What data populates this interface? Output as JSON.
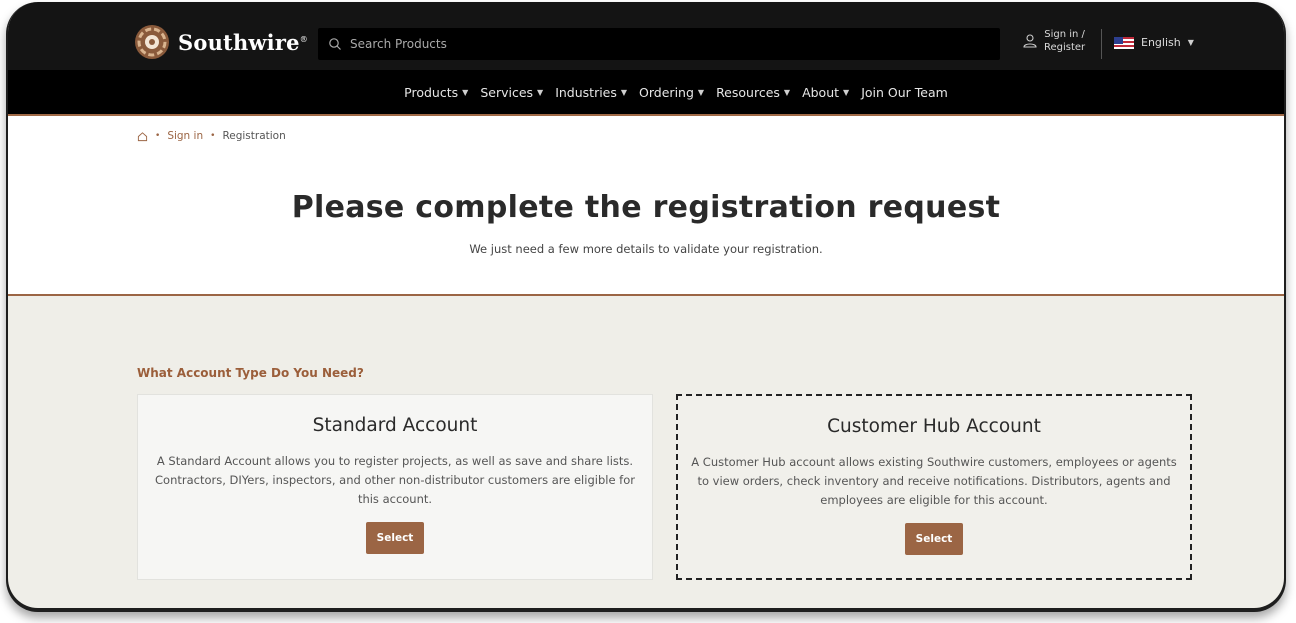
{
  "header": {
    "brand": "Southwire",
    "brand_mark": "®",
    "search_placeholder": "Search Products",
    "signin_line1": "Sign in /",
    "signin_line2": "Register",
    "language": "English"
  },
  "nav": {
    "items": [
      {
        "label": "Products",
        "dropdown": true
      },
      {
        "label": "Services",
        "dropdown": true
      },
      {
        "label": "Industries",
        "dropdown": true
      },
      {
        "label": "Ordering",
        "dropdown": true
      },
      {
        "label": "Resources",
        "dropdown": true
      },
      {
        "label": "About",
        "dropdown": true
      },
      {
        "label": "Join Our Team",
        "dropdown": false
      }
    ]
  },
  "breadcrumb": {
    "home_icon": "home-icon",
    "signin": "Sign in",
    "current": "Registration"
  },
  "hero": {
    "title": "Please complete the registration request",
    "subtitle": "We just need a few more details to validate your registration."
  },
  "accounts": {
    "question": "What Account Type Do You Need?",
    "standard": {
      "title": "Standard Account",
      "description": "A Standard Account allows you to register projects, as well as save and share lists. Contractors, DIYers, inspectors, and other non-distributor customers are eligible for this account.",
      "button": "Select"
    },
    "hub": {
      "title": "Customer Hub Account",
      "description": "A Customer Hub account allows existing Southwire customers, employees or agents to view orders, check inventory and receive notifications. Distributors, agents and employees are eligible for this account.",
      "button": "Select"
    }
  },
  "colors": {
    "accent": "#9b6544",
    "header_bg": "#141414",
    "nav_bg": "#000000",
    "section_bg": "#efeee8"
  }
}
